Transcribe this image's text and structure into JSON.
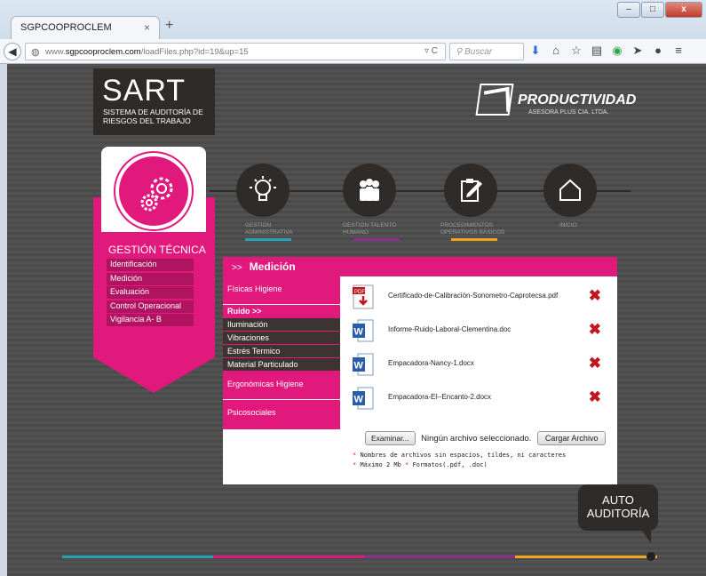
{
  "browser": {
    "tab_title": "SGPCOOPROCLEM",
    "tab_close": "×",
    "new_tab": "+",
    "url_prefix": "www.",
    "url_domain": "sgpcooproclem.com",
    "url_path": "/loadFiles.php?id=19&up=15",
    "search_placeholder": "Buscar",
    "win_min": "–",
    "win_max": "□",
    "win_close": "x"
  },
  "header": {
    "sart_title": "SART",
    "sart_subtitle": "SISTEMA DE AUDITORÍA DE RIESGOS DEL TRABAJO",
    "brand_name": "PRODUCTIVIDAD",
    "brand_sub": "ASESORA PLUS CIA. LTDA."
  },
  "left": {
    "title": "GESTIÓN TÉCNICA",
    "menu": [
      "Identificación",
      "Medición",
      "Evaluación",
      "Control Operacional",
      "Vigilancia A- B"
    ]
  },
  "timeline": {
    "nodes": [
      {
        "label": "GESTIÓN ADMINISTRATIVA",
        "color": "#22a3b8"
      },
      {
        "label": "GESTIÓN TALENTO HUMANO",
        "color": "#8a2f8f"
      },
      {
        "label": "PROCEDIMIENTOS OPERATIVOS BÁSICOS",
        "color": "#f2a51a"
      },
      {
        "label": "INICIO",
        "color": ""
      }
    ]
  },
  "card": {
    "prefix": ">>",
    "title": "Medición",
    "side": {
      "cat1": "Físicas Higiene",
      "current": "Ruido >>",
      "subs": [
        "Iluminación",
        "Vibraciones",
        "Estrés Termico",
        "Material Particulado"
      ],
      "cat2": "Ergonómicas Higiene",
      "cat3": "Psicosociales"
    },
    "files": [
      {
        "name": "Certificado-de-Calibración-Sonometro-Caprotecsa.pdf",
        "type": "pdf"
      },
      {
        "name": "Informe-Ruido-Laboral-Clementina.doc",
        "type": "word"
      },
      {
        "name": "Empacadora-Nancy-1.docx",
        "type": "word"
      },
      {
        "name": "Empacadora-El--Encanto-2.docx",
        "type": "word"
      }
    ],
    "delete_glyph": "✖",
    "browse_label": "Examinar...",
    "no_file_label": "Ningún archivo seleccionado.",
    "upload_label": "Cargar Archivo",
    "note1": "Nombres de archivos sin espacios, tildes, ni caracteres",
    "note2a": "Máximo 2 Mb",
    "note2b": "Formatos(.pdf, .doc)",
    "asterisk": "*"
  },
  "auto": {
    "line1": "AUTO",
    "line2": "AUDITORÍA"
  },
  "colors": {
    "pink": "#e2197d",
    "dark": "#2e2b28",
    "teal": "#22a3b8",
    "purple": "#8a2f8f",
    "orange": "#f2a51a"
  }
}
